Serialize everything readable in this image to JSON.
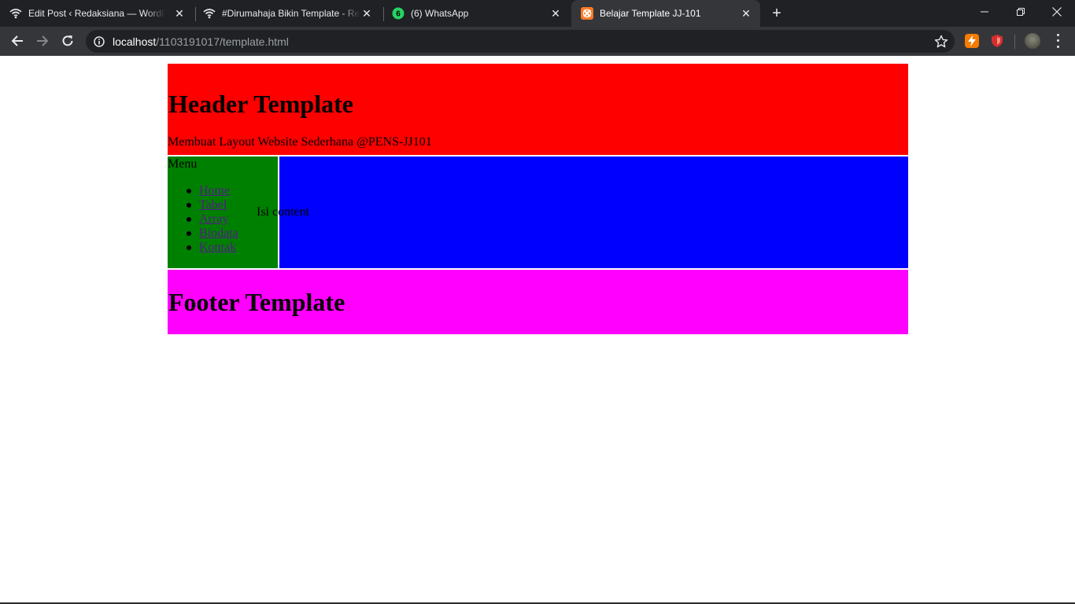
{
  "browser": {
    "tabs": [
      {
        "title": "Edit Post ‹ Redaksiana — WordPress",
        "icon": "wifi-icon",
        "active": false
      },
      {
        "title": "#Dirumahaja Bikin Template - Redaksiana",
        "icon": "wifi-icon",
        "active": false
      },
      {
        "title": "(6) WhatsApp",
        "icon": "whatsapp-icon",
        "badge": "6",
        "active": false
      },
      {
        "title": "Belajar Template JJ-101",
        "icon": "xampp-icon",
        "active": true
      }
    ],
    "close_glyph": "✕",
    "new_tab_glyph": "+",
    "address": {
      "host": "localhost",
      "path": "/1103191017/template.html"
    },
    "colors": {
      "frame": "#202124",
      "toolbar": "#35363a"
    }
  },
  "page": {
    "header": {
      "title": "Header Template",
      "subtitle": "Membuat Layout Website Sederhana @PENS-JJ101",
      "color": "#ff0000"
    },
    "nav": {
      "title": "Menu",
      "items": [
        "Home",
        "Tabel",
        "Array",
        "Biodata",
        "Kontak"
      ],
      "color": "#008000"
    },
    "main": {
      "text": "Isi content",
      "color": "#0000ff"
    },
    "footer": {
      "title": "Footer Template",
      "color": "#ff00ff"
    }
  }
}
